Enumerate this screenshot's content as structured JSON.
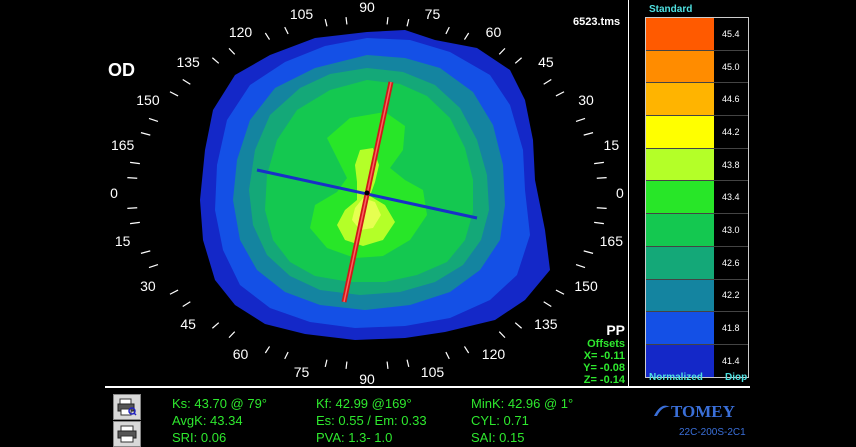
{
  "eye": "OD",
  "filename": "6523.tms",
  "ring_labels": [
    {
      "angle_text": "90",
      "deg": 90
    },
    {
      "angle_text": "105",
      "deg": 105
    },
    {
      "angle_text": "120",
      "deg": 120
    },
    {
      "angle_text": "135",
      "deg": 135
    },
    {
      "angle_text": "150",
      "deg": 150
    },
    {
      "angle_text": "165",
      "deg": 165
    },
    {
      "angle_text": "0",
      "deg": 180
    },
    {
      "angle_text": "15",
      "deg": 195
    },
    {
      "angle_text": "30",
      "deg": 210
    },
    {
      "angle_text": "45",
      "deg": 225
    },
    {
      "angle_text": "60",
      "deg": 240
    },
    {
      "angle_text": "75",
      "deg": 255
    },
    {
      "angle_text": "90",
      "deg": 270
    },
    {
      "angle_text": "105",
      "deg": 285
    },
    {
      "angle_text": "120",
      "deg": 300
    },
    {
      "angle_text": "135",
      "deg": 315
    },
    {
      "angle_text": "150",
      "deg": 330
    },
    {
      "angle_text": "165",
      "deg": 345
    },
    {
      "angle_text": "0",
      "deg": 0
    },
    {
      "angle_text": "15",
      "deg": 15
    },
    {
      "angle_text": "30",
      "deg": 30
    },
    {
      "angle_text": "45",
      "deg": 45
    },
    {
      "angle_text": "60",
      "deg": 60
    },
    {
      "angle_text": "75",
      "deg": 75
    }
  ],
  "pp": {
    "title": "PP",
    "offsets_label": "Offsets",
    "x": "X= -0.11",
    "y": "Y= -0.08",
    "z": "Z= -0.14"
  },
  "legend": {
    "title": "Standard",
    "bottom_left": "Normalized",
    "bottom_right": "Diop",
    "scale": [
      {
        "value": "45.4",
        "color": "#ff5a00"
      },
      {
        "value": "45.0",
        "color": "#ff8c00"
      },
      {
        "value": "44.6",
        "color": "#ffb400"
      },
      {
        "value": "44.2",
        "color": "#ffff00"
      },
      {
        "value": "43.8",
        "color": "#b4ff28"
      },
      {
        "value": "43.4",
        "color": "#28e628"
      },
      {
        "value": "43.0",
        "color": "#14c850"
      },
      {
        "value": "42.6",
        "color": "#14a878"
      },
      {
        "value": "42.2",
        "color": "#1484a0"
      },
      {
        "value": "41.8",
        "color": "#1450e6"
      },
      {
        "value": "41.4",
        "color": "#1428c8"
      }
    ]
  },
  "readouts": {
    "ks": "Ks: 43.70 @ 79°",
    "kf": "Kf: 42.99 @169°",
    "mink": "MinK: 42.96 @  1°",
    "avgk": "AvgK: 43.34",
    "es_em": "Es: 0.55 / Em: 0.33",
    "cyl": "CYL:  0.71",
    "sri": "SRI: 0.06",
    "pva": "PVA:   1.3-  1.0",
    "sai": "SAI: 0.15"
  },
  "brand": {
    "logo": "TOMEY",
    "code": "22C-200S-2C1"
  },
  "colors": {
    "steep_axis": "#d01818",
    "flat_axis": "#1830c8",
    "readout_green": "#2ee82e",
    "legend_cyan": "#4fe0e0"
  },
  "icons": {
    "print_preview": "print-preview-icon",
    "print": "printer-icon"
  }
}
